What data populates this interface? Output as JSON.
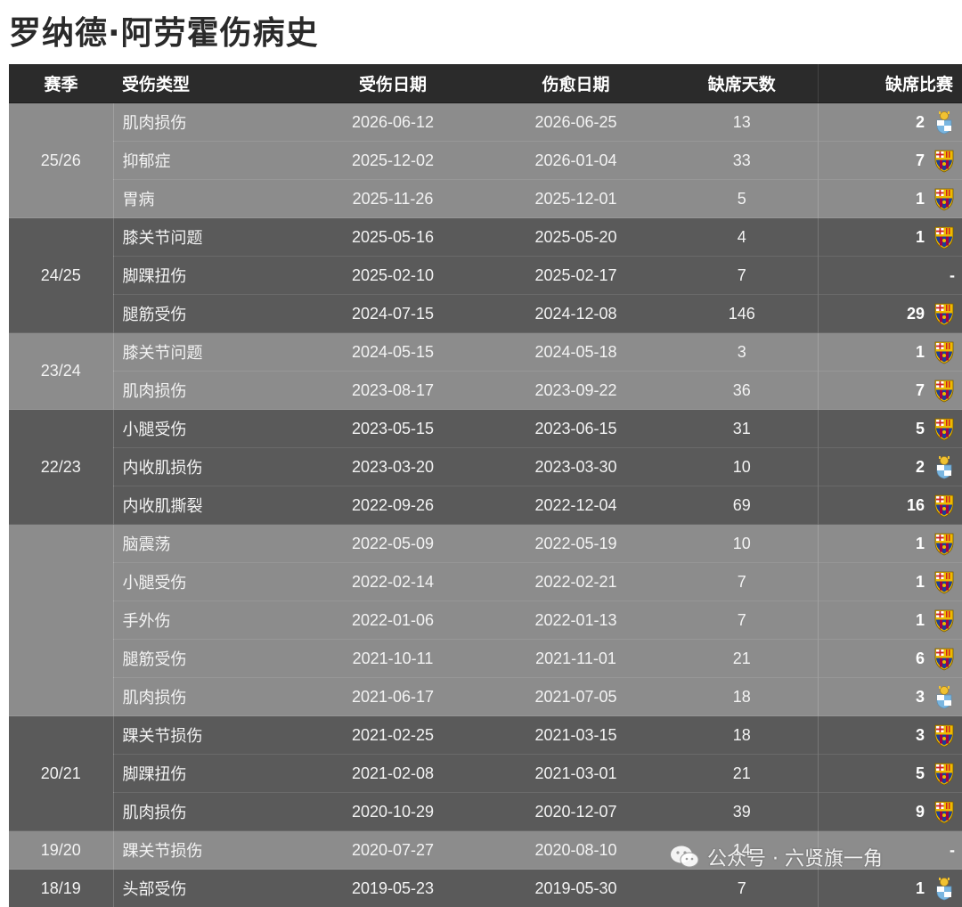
{
  "title": "罗纳德·阿劳霍伤病史",
  "headers": {
    "season": "赛季",
    "type": "受伤类型",
    "start": "受伤日期",
    "end": "伤愈日期",
    "days": "缺席天数",
    "games": "缺席比赛"
  },
  "rows": [
    {
      "season": "25/26",
      "type": "肌肉损伤",
      "start": "2026-06-12",
      "end": "2026-06-25",
      "days": "13",
      "games": "2",
      "crest": "uruguay-crest-icon"
    },
    {
      "season": "25/26",
      "type": "抑郁症",
      "start": "2025-12-02",
      "end": "2026-01-04",
      "days": "33",
      "games": "7",
      "crest": "barcelona-crest-icon"
    },
    {
      "season": "25/26",
      "type": "胃病",
      "start": "2025-11-26",
      "end": "2025-12-01",
      "days": "5",
      "games": "1",
      "crest": "barcelona-crest-icon"
    },
    {
      "season": "24/25",
      "type": "膝关节问题",
      "start": "2025-05-16",
      "end": "2025-05-20",
      "days": "4",
      "games": "1",
      "crest": "barcelona-crest-icon"
    },
    {
      "season": "24/25",
      "type": "脚踝扭伤",
      "start": "2025-02-10",
      "end": "2025-02-17",
      "days": "7",
      "games": "-",
      "crest": ""
    },
    {
      "season": "24/25",
      "type": "腿筋受伤",
      "start": "2024-07-15",
      "end": "2024-12-08",
      "days": "146",
      "games": "29",
      "crest": "barcelona-crest-icon"
    },
    {
      "season": "23/24",
      "type": "膝关节问题",
      "start": "2024-05-15",
      "end": "2024-05-18",
      "days": "3",
      "games": "1",
      "crest": "barcelona-crest-icon"
    },
    {
      "season": "23/24",
      "type": "肌肉损伤",
      "start": "2023-08-17",
      "end": "2023-09-22",
      "days": "36",
      "games": "7",
      "crest": "barcelona-crest-icon"
    },
    {
      "season": "22/23",
      "type": "小腿受伤",
      "start": "2023-05-15",
      "end": "2023-06-15",
      "days": "31",
      "games": "5",
      "crest": "barcelona-crest-icon"
    },
    {
      "season": "22/23",
      "type": "内收肌损伤",
      "start": "2023-03-20",
      "end": "2023-03-30",
      "days": "10",
      "games": "2",
      "crest": "uruguay-crest-icon"
    },
    {
      "season": "22/23",
      "type": "内收肌撕裂",
      "start": "2022-09-26",
      "end": "2022-12-04",
      "days": "69",
      "games": "16",
      "crest": "barcelona-crest-icon"
    },
    {
      "season": "",
      "type": "脑震荡",
      "start": "2022-05-09",
      "end": "2022-05-19",
      "days": "10",
      "games": "1",
      "crest": "barcelona-crest-icon"
    },
    {
      "season": "",
      "type": "小腿受伤",
      "start": "2022-02-14",
      "end": "2022-02-21",
      "days": "7",
      "games": "1",
      "crest": "barcelona-crest-icon"
    },
    {
      "season": "",
      "type": "手外伤",
      "start": "2022-01-06",
      "end": "2022-01-13",
      "days": "7",
      "games": "1",
      "crest": "barcelona-crest-icon"
    },
    {
      "season": "",
      "type": "腿筋受伤",
      "start": "2021-10-11",
      "end": "2021-11-01",
      "days": "21",
      "games": "6",
      "crest": "barcelona-crest-icon"
    },
    {
      "season": "",
      "type": "肌肉损伤",
      "start": "2021-06-17",
      "end": "2021-07-05",
      "days": "18",
      "games": "3",
      "crest": "uruguay-crest-icon"
    },
    {
      "season": "20/21",
      "type": "踝关节损伤",
      "start": "2021-02-25",
      "end": "2021-03-15",
      "days": "18",
      "games": "3",
      "crest": "barcelona-crest-icon"
    },
    {
      "season": "20/21",
      "type": "脚踝扭伤",
      "start": "2021-02-08",
      "end": "2021-03-01",
      "days": "21",
      "games": "5",
      "crest": "barcelona-crest-icon"
    },
    {
      "season": "20/21",
      "type": "肌肉损伤",
      "start": "2020-10-29",
      "end": "2020-12-07",
      "days": "39",
      "games": "9",
      "crest": "barcelona-crest-icon"
    },
    {
      "season": "19/20",
      "type": "踝关节损伤",
      "start": "2020-07-27",
      "end": "2020-08-10",
      "days": "14",
      "games": "-",
      "crest": ""
    },
    {
      "season": "18/19",
      "type": "头部受伤",
      "start": "2019-05-23",
      "end": "2019-05-30",
      "days": "7",
      "games": "1",
      "crest": "uruguay-crest-icon"
    }
  ],
  "groups": [
    {
      "season": "25/26",
      "rows": 3,
      "shade": "light"
    },
    {
      "season": "24/25",
      "rows": 3,
      "shade": "dark"
    },
    {
      "season": "23/24",
      "rows": 2,
      "shade": "light"
    },
    {
      "season": "22/23",
      "rows": 3,
      "shade": "dark"
    },
    {
      "season": "",
      "rows": 5,
      "shade": "light"
    },
    {
      "season": "20/21",
      "rows": 3,
      "shade": "dark"
    },
    {
      "season": "19/20",
      "rows": 1,
      "shade": "light"
    },
    {
      "season": "18/19",
      "rows": 1,
      "shade": "dark"
    }
  ],
  "watermark": "公众号 · 六贤旗一角",
  "colors": {
    "header_bg": "#2b2b2b",
    "row_light": "#8c8c8c",
    "row_dark": "#5a5a5a",
    "barca_blue": "#1c3f94",
    "barca_red": "#a50044",
    "barca_gold": "#edbb00",
    "uruguay_blue": "#7ab6e0"
  }
}
